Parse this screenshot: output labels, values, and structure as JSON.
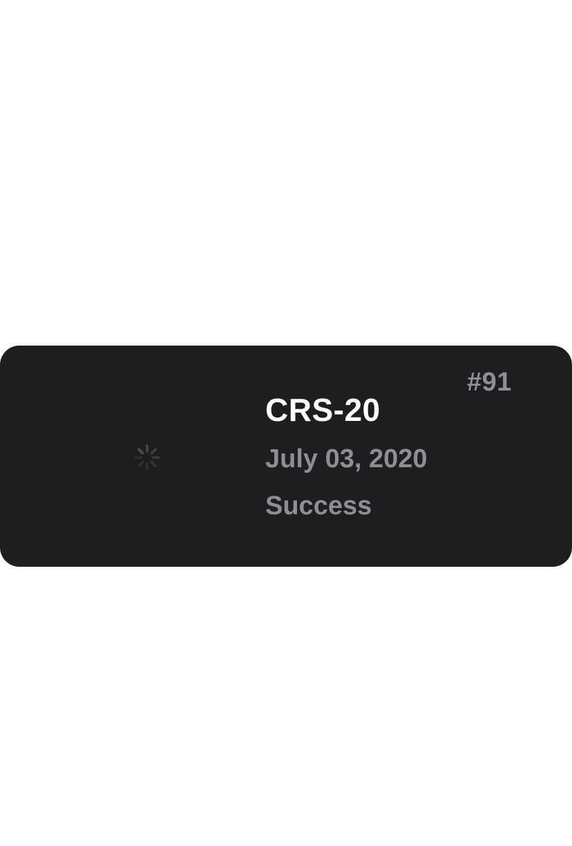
{
  "launch": {
    "flight_number": "#91",
    "mission_name": "CRS-20",
    "date": "July 03, 2020",
    "status": "Success"
  },
  "patch_image": {
    "state": "loading",
    "icon": "loading-spinner-icon"
  },
  "colors": {
    "card_background": "#1e1e20",
    "page_background": "#ffffff",
    "title_text": "#ffffff",
    "secondary_text": "#8e8e93"
  }
}
